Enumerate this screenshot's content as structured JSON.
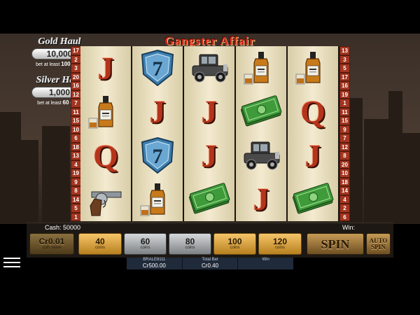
{
  "game": {
    "title": "Gangster Affair"
  },
  "jackpots": [
    {
      "name": "Gold Haul",
      "amount": "10,000",
      "requirement_prefix": "bet at least",
      "requirement_value": "100",
      "requirement_suffix": "coins"
    },
    {
      "name": "Silver Haul",
      "amount": "1,000",
      "requirement_prefix": "bet at least",
      "requirement_value": "60",
      "requirement_suffix": "coins"
    }
  ],
  "paylines": {
    "left": [
      "17",
      "2",
      "3",
      "20",
      "16",
      "12",
      "7",
      "11",
      "15",
      "10",
      "6",
      "18",
      "13",
      "4",
      "19",
      "9",
      "8",
      "14",
      "5",
      "1"
    ],
    "right": [
      "13",
      "3",
      "5",
      "17",
      "16",
      "19",
      "1",
      "11",
      "15",
      "9",
      "7",
      "12",
      "8",
      "20",
      "10",
      "18",
      "14",
      "4",
      "2",
      "6"
    ]
  },
  "reels": [
    [
      "J",
      "whiskey",
      "Q",
      "revolver"
    ],
    [
      "badge-7",
      "J",
      "badge-7",
      "whiskey"
    ],
    [
      "car",
      "J",
      "J",
      "cash"
    ],
    [
      "whiskey",
      "cash",
      "car",
      "J"
    ],
    [
      "whiskey",
      "Q",
      "J",
      "cash"
    ]
  ],
  "badge_number": "7",
  "panel": {
    "cash_label": "Cash: 50000",
    "win_label": "Win:",
    "coin_value": {
      "value": "Cr0.01",
      "label": "coin value"
    },
    "bets": [
      {
        "value": "40",
        "label": "coins",
        "style": "gold"
      },
      {
        "value": "60",
        "label": "coins",
        "style": "silver"
      },
      {
        "value": "80",
        "label": "coins",
        "style": "silver"
      },
      {
        "value": "100",
        "label": "coins",
        "style": "gold"
      },
      {
        "value": "120",
        "label": "coins",
        "style": "gold"
      }
    ],
    "spin_label": "SPIN",
    "auto_spin_line1": "AUTO",
    "auto_spin_line2": "SPIN"
  },
  "info": {
    "player_id": "BRALE8111",
    "balance": "Cr500.00",
    "total_bet_label": "Total Bet",
    "total_bet": "Cr0.40",
    "win_label": "Win",
    "win_value": ""
  },
  "colors": {
    "title": "#d42a1a",
    "letter": "#b5341a",
    "cash_note": "#3f9a3a",
    "badge": "#3d7fb0"
  }
}
